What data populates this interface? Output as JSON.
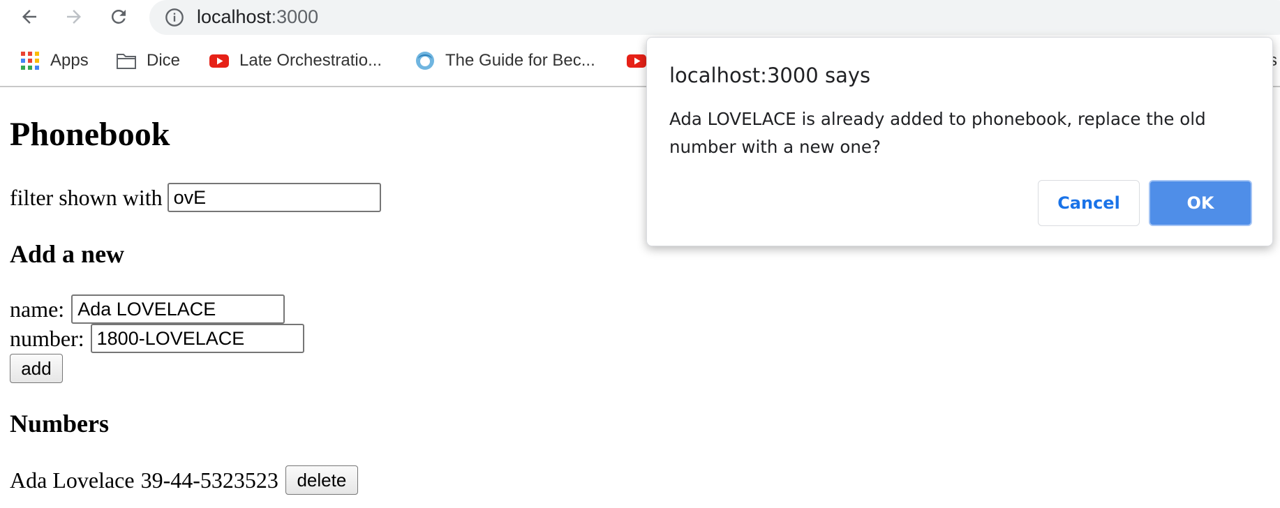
{
  "browser": {
    "url_host": "localhost",
    "url_port": ":3000",
    "bookmarks": [
      {
        "label": "Apps",
        "icon": "apps-grid-icon"
      },
      {
        "label": "Dice",
        "icon": "folder-icon"
      },
      {
        "label": "Late Orchestratio...",
        "icon": "youtube-icon"
      },
      {
        "label": "The Guide for Bec...",
        "icon": "avatar-icon"
      },
      {
        "label": "",
        "icon": "youtube-icon"
      },
      {
        "label": "s",
        "icon": ""
      }
    ]
  },
  "page": {
    "title": "Phonebook",
    "filter": {
      "label": "filter shown with",
      "value": "ovE"
    },
    "add_heading": "Add a new",
    "name_field": {
      "label": "name:",
      "value": "Ada LOVELACE"
    },
    "number_field": {
      "label": "number:",
      "value": "1800-LOVELACE"
    },
    "add_button": "add",
    "numbers_heading": "Numbers",
    "entries": [
      {
        "name": "Ada Lovelace",
        "number": "39-44-5323523",
        "delete_label": "delete"
      }
    ]
  },
  "dialog": {
    "title": "localhost:3000 says",
    "message": "Ada LOVELACE is already added to phonebook, replace the old number with a new one?",
    "cancel_label": "Cancel",
    "ok_label": "OK"
  },
  "colors": {
    "ok_button": "#4f8ee8",
    "cancel_text": "#1a73e8",
    "youtube_red": "#e62117"
  }
}
